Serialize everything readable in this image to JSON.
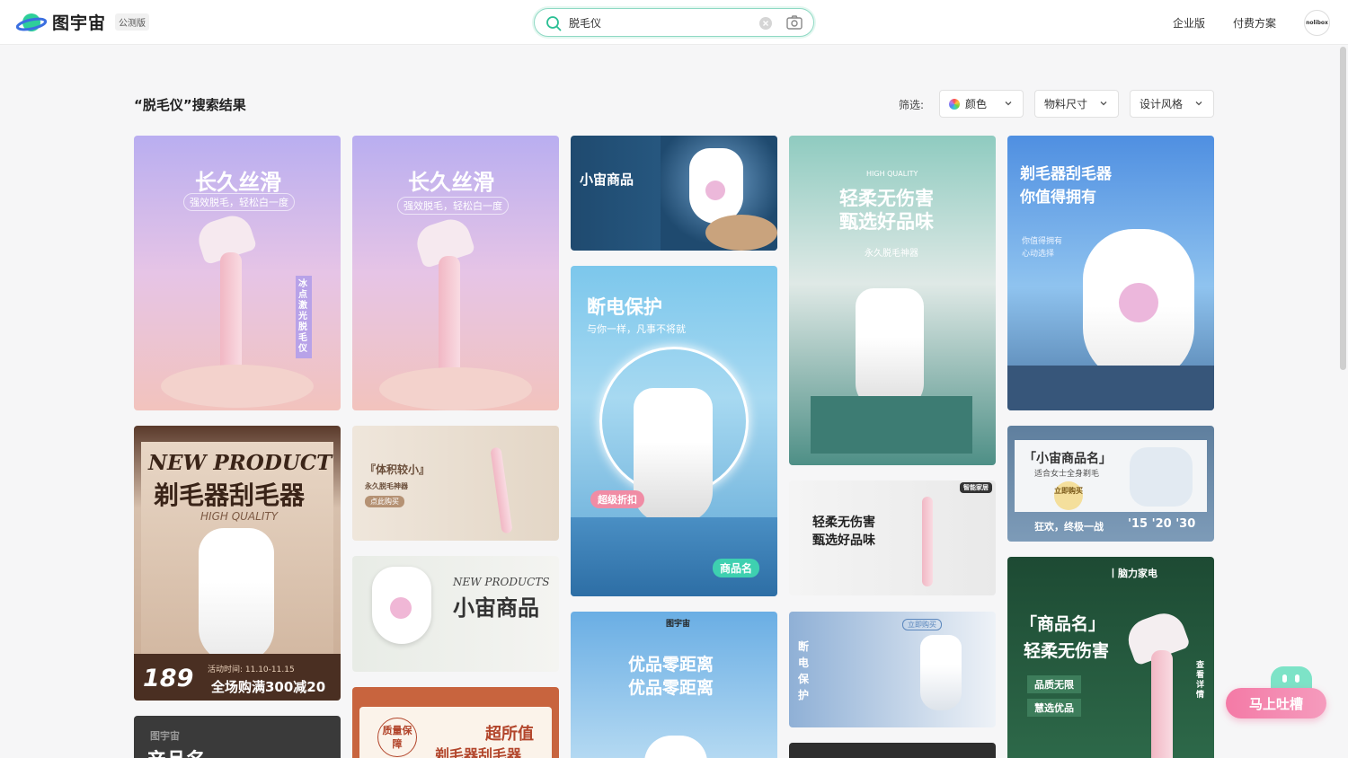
{
  "brand": {
    "name": "图宇宙",
    "badge": "公测版"
  },
  "search": {
    "query": "脱毛仪"
  },
  "nav": {
    "enterprise": "企业版",
    "pricing": "付费方案",
    "avatar_text": "nolibox"
  },
  "results": {
    "title": "“脱毛仪”搜索结果",
    "filter_label": "筛选:"
  },
  "filters": {
    "color": "颜色",
    "size": "物料尺寸",
    "style": "设计风格"
  },
  "cards": {
    "c1": {
      "title": "长久丝滑",
      "sub": "强效脱毛，轻松白一度",
      "side": "冰点激光脱毛仪"
    },
    "c2": {
      "title": "长久丝滑",
      "sub": "强效脱毛，轻松白一度"
    },
    "c3": {
      "title": "小宙商品"
    },
    "c4": {
      "tag": "HIGH QUALITY",
      "line1": "轻柔无伤害",
      "line2": "甄选好品味",
      "sub": "永久脱毛神器"
    },
    "c5": {
      "line1": "剃毛器刮毛器",
      "line2": "你值得拥有",
      "sub1": "你值得拥有",
      "sub2": "心动选择"
    },
    "c6": {
      "line1": "NEW PRODUCT",
      "line2": "剃毛器刮毛器",
      "script": "HIGH QUALITY",
      "price": "189",
      "date": "活动时间: 11.10-11.15",
      "promo": "全场购满300减20"
    },
    "c7": {
      "title": "『体积较小』",
      "sub": "永久脱毛神器",
      "btn": "点此购买"
    },
    "c8": {
      "title": "断电保护",
      "sub": "与你一样，凡事不将就",
      "badge": "超级折扣",
      "btn": "商品名"
    },
    "c9": {
      "line1": "轻柔无伤害",
      "line2": "甄选好品味",
      "tag": "智能家居"
    },
    "c10": {
      "title": "「小宙商品名」",
      "sub": "适合女士全身剃毛",
      "badge": "立即购买",
      "slogan": "狂欢，终极一战",
      "nums": "'15 '20 '30"
    },
    "c11": {
      "script": "NEW PRODUCTS",
      "title": "小宙商品"
    },
    "c12": {
      "brand": "丨脑力家电",
      "line1": "「商品名」",
      "line2": "轻柔无伤害",
      "tag1": "品质无限",
      "tag2": "慧选优品",
      "side": "查看详情"
    },
    "c13": {
      "brand": "图宇宙",
      "line1": "优品零距离",
      "line2": "优品零距离"
    },
    "c14": {
      "side": "断电保护",
      "btn": "立即购买"
    },
    "c15": {
      "badge": "质量保障",
      "title": "超所值",
      "sub": "剃毛器刮毛器"
    },
    "c16": {
      "brand": "图宇宙",
      "title": "产品名"
    }
  },
  "feedback": {
    "label": "马上吐槽"
  }
}
